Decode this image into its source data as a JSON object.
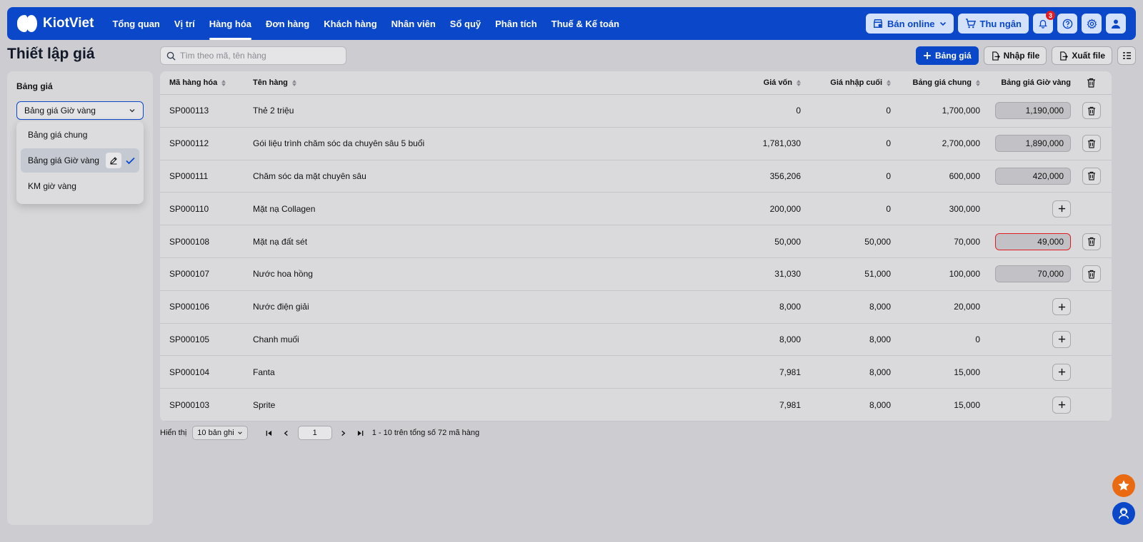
{
  "brand": {
    "name": "KiotViet"
  },
  "nav": [
    {
      "label": "Tổng quan",
      "active": false
    },
    {
      "label": "Vị trí",
      "active": false
    },
    {
      "label": "Hàng hóa",
      "active": true
    },
    {
      "label": "Đơn hàng",
      "active": false
    },
    {
      "label": "Khách hàng",
      "active": false
    },
    {
      "label": "Nhân viên",
      "active": false
    },
    {
      "label": "Sổ quỹ",
      "active": false
    },
    {
      "label": "Phân tích",
      "active": false
    },
    {
      "label": "Thuế & Kế toán",
      "active": false
    }
  ],
  "topbar": {
    "sell_online": "Bán online",
    "cashier": "Thu ngân",
    "notification_count": "3"
  },
  "page": {
    "title": "Thiết lập giá"
  },
  "search": {
    "placeholder": "Tìm theo mã, tên hàng"
  },
  "toolbar": {
    "add_pricebook": "Bảng giá",
    "import": "Nhập file",
    "export": "Xuất file"
  },
  "left_panel": {
    "label": "Bảng giá",
    "selected": "Bảng giá Giờ vàng",
    "options": [
      {
        "label": "Bảng giá chung",
        "selected": false
      },
      {
        "label": "Bảng giá Giờ vàng",
        "selected": true
      },
      {
        "label": "KM giờ vàng",
        "selected": false
      }
    ]
  },
  "table": {
    "headers": {
      "code": "Mã hàng hóa",
      "name": "Tên hàng",
      "cost": "Giá vốn",
      "last_import": "Giá nhập cuối",
      "general": "Bảng giá chung",
      "gold": "Bảng giá Giờ vàng"
    },
    "rows": [
      {
        "code": "SP000113",
        "name": "Thẻ 2 triệu",
        "cost": "0",
        "last_import": "0",
        "general": "1,700,000",
        "gold": "1,190,000",
        "error": false
      },
      {
        "code": "SP000112",
        "name": "Gói liệu trình chăm sóc da chuyên sâu 5 buổi",
        "cost": "1,781,030",
        "last_import": "0",
        "general": "2,700,000",
        "gold": "1,890,000",
        "error": false
      },
      {
        "code": "SP000111",
        "name": "Chăm sóc da mặt chuyên sâu",
        "cost": "356,206",
        "last_import": "0",
        "general": "600,000",
        "gold": "420,000",
        "error": false
      },
      {
        "code": "SP000110",
        "name": "Mặt nạ Collagen",
        "cost": "200,000",
        "last_import": "0",
        "general": "300,000",
        "gold": null,
        "error": false
      },
      {
        "code": "SP000108",
        "name": "Mặt nạ đất sét",
        "cost": "50,000",
        "last_import": "50,000",
        "general": "70,000",
        "gold": "49,000",
        "error": true
      },
      {
        "code": "SP000107",
        "name": "Nước hoa hồng",
        "cost": "31,030",
        "last_import": "51,000",
        "general": "100,000",
        "gold": "70,000",
        "error": false
      },
      {
        "code": "SP000106",
        "name": "Nước điện giải",
        "cost": "8,000",
        "last_import": "8,000",
        "general": "20,000",
        "gold": null,
        "error": false
      },
      {
        "code": "SP000105",
        "name": "Chanh muối",
        "cost": "8,000",
        "last_import": "8,000",
        "general": "0",
        "gold": null,
        "error": false
      },
      {
        "code": "SP000104",
        "name": "Fanta",
        "cost": "7,981",
        "last_import": "8,000",
        "general": "15,000",
        "gold": null,
        "error": false
      },
      {
        "code": "SP000103",
        "name": "Sprite",
        "cost": "7,981",
        "last_import": "8,000",
        "general": "15,000",
        "gold": null,
        "error": false
      }
    ]
  },
  "pagination": {
    "show_label": "Hiển thị",
    "per_page": "10 bản ghi",
    "current_page": "1",
    "summary": "1 - 10 trên tổng số 72 mã hàng"
  },
  "colors": {
    "brand_blue": "#0a47c9",
    "error_red": "#e11d24",
    "accent_orange": "#ea6a12"
  }
}
